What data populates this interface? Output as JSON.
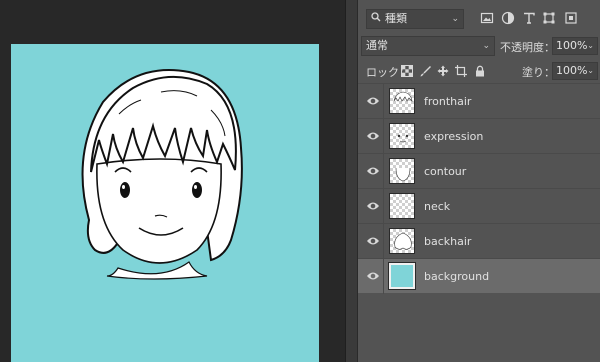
{
  "colors": {
    "canvas_fill": "#7fd4d8",
    "panel_bg": "#535353",
    "selected_row": "#6b6b6b",
    "workspace_bg": "#282828"
  },
  "layers_panel": {
    "filter": {
      "kind_icon": "search-icon",
      "kind_label": "種類",
      "filter_icons": [
        "image-filter-icon",
        "adjustment-filter-icon",
        "type-filter-icon",
        "shape-filter-icon",
        "smart-object-filter-icon"
      ]
    },
    "blend": {
      "mode": "通常",
      "opacity_label": "不透明度：",
      "opacity_value": "100%"
    },
    "lock": {
      "label": "ロック：",
      "icons": [
        "lock-transparent-pixels-icon",
        "lock-image-pixels-icon",
        "lock-position-icon",
        "lock-artboard-icon",
        "lock-all-icon"
      ],
      "fill_label": "塗り：",
      "fill_value": "100%"
    },
    "layers": [
      {
        "name": "fronthair",
        "visible": true,
        "selected": false,
        "thumb": "transparent"
      },
      {
        "name": "expression",
        "visible": true,
        "selected": false,
        "thumb": "transparent"
      },
      {
        "name": "contour",
        "visible": true,
        "selected": false,
        "thumb": "transparent"
      },
      {
        "name": "neck",
        "visible": true,
        "selected": false,
        "thumb": "transparent"
      },
      {
        "name": "backhair",
        "visible": true,
        "selected": false,
        "thumb": "transparent"
      },
      {
        "name": "background",
        "visible": true,
        "selected": true,
        "thumb": "filled"
      }
    ]
  }
}
